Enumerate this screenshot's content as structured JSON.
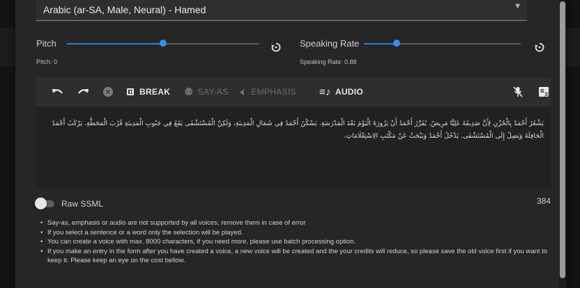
{
  "voice": {
    "selected": "Arabic (ar-SA, Male, Neural) - Hamed"
  },
  "pitch": {
    "label": "Pitch",
    "value_text": "Pitch: 0",
    "level": 0.5
  },
  "rate": {
    "label": "Speaking Rate",
    "value_text": "Speaking Rate: 0.88",
    "level": 0.44
  },
  "toolbar": {
    "break": "BREAK",
    "say_as": "SAY-AS",
    "emphasis": "EMPHASIS",
    "audio": "AUDIO"
  },
  "editor": {
    "text": "يَشْعُرُ أَحْمَدُ بِالْحُزْنِ لِأَنَّ صَدِيقَهُ عَلِيًّا مَرِيضٌ. يُقَرِّرُ أَحْمَدُ أَنْ يَزُورَهُ الْيَوْمَ بَعْدَ الْمَدْرَسَةِ. يَسْكُنُ أَحْمَدُ فِي شَمَالِ الْمَدِينَةِ، وَلَكِنَّ الْمُسْتَشْفَى يَقَعُ فِي جَنُوبِ الْمَدِينَةِ قُرْبَ الْمَحَطَّةِ. يَرْكَبُ أَحْمَدُ الْحَافِلَةَ وَيَصِلُ إِلَى الْمُسْتَشْفَى. يَدْخُلُ أَحْمَدُ وَيَبْحَثُ عَنْ مَكْتَبِ الِاسْتِعْلَامَاتِ."
  },
  "raw_ssml": {
    "label": "Raw SSML",
    "enabled": false
  },
  "char_count": "384",
  "notes": [
    "Say-as, emphasis or audio are not supported by all voices, remove them in case of error",
    "If you select a sentence or a word only the selection will be played.",
    "You can create a voice with max. 8000 characters, if you need more, please use batch processing option.",
    "If you make an entry in the form after you have created a voice, a new voice will be created and the your credits will reduce, so please save the old voice first if you want to keep it. Please keep an eye on the cost bellow."
  ],
  "colors": {
    "accent": "#2f7fd9",
    "panel": "#262626",
    "toolbar": "#2e2e2e",
    "editor": "#212121"
  }
}
